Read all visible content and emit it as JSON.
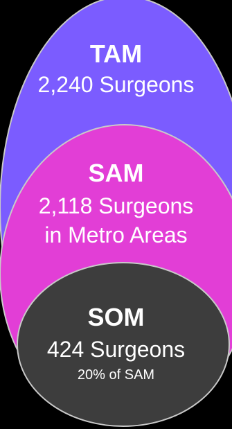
{
  "colors": {
    "background": "#000000",
    "tam": "#7b5cff",
    "sam": "#e23ed6",
    "som": "#3d3d3d",
    "stroke": "#c9c9c9",
    "text": "#ffffff"
  },
  "tam": {
    "title": "TAM",
    "value": "2,240 Surgeons"
  },
  "sam": {
    "title": "SAM",
    "value_line1": "2,118 Surgeons",
    "value_line2": "in Metro Areas"
  },
  "som": {
    "title": "SOM",
    "value": "424 Surgeons",
    "note": "20% of SAM"
  }
}
